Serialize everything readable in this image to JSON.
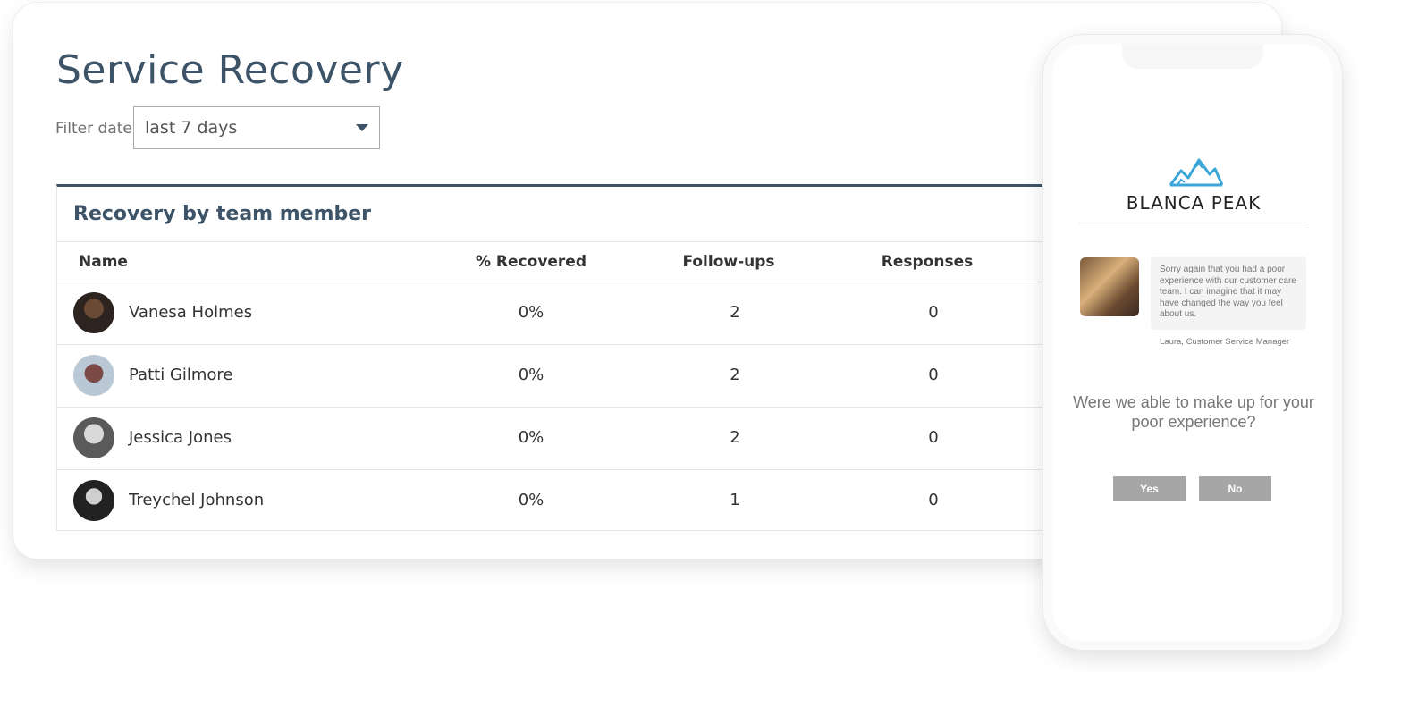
{
  "header": {
    "title": "Service Recovery",
    "filter_label": "Filter date",
    "filter_value": "last 7 days"
  },
  "table": {
    "title": "Recovery by team member",
    "columns": [
      "Name",
      "% Recovered",
      "Follow-ups",
      "Responses"
    ],
    "rows": [
      {
        "name": "Vanesa Holmes",
        "recovered": "0%",
        "followups": "2",
        "responses": "0"
      },
      {
        "name": "Patti Gilmore",
        "recovered": "0%",
        "followups": "2",
        "responses": "0"
      },
      {
        "name": "Jessica Jones",
        "recovered": "0%",
        "followups": "2",
        "responses": "0"
      },
      {
        "name": "Treychel Johnson",
        "recovered": "0%",
        "followups": "1",
        "responses": "0"
      }
    ]
  },
  "phone": {
    "brand": "BLANCA PEAK",
    "message": "Sorry again that you had a poor experience with our customer care team. I can imagine that it may have changed the way you feel about us.",
    "signature": "Laura, Customer Service Manager",
    "question": "Were we able to make up for your poor experience?",
    "yes_label": "Yes",
    "no_label": "No"
  },
  "colors": {
    "accent": "#3d5368",
    "logo": "#3aa6d8",
    "button": "#a6a6a6"
  }
}
